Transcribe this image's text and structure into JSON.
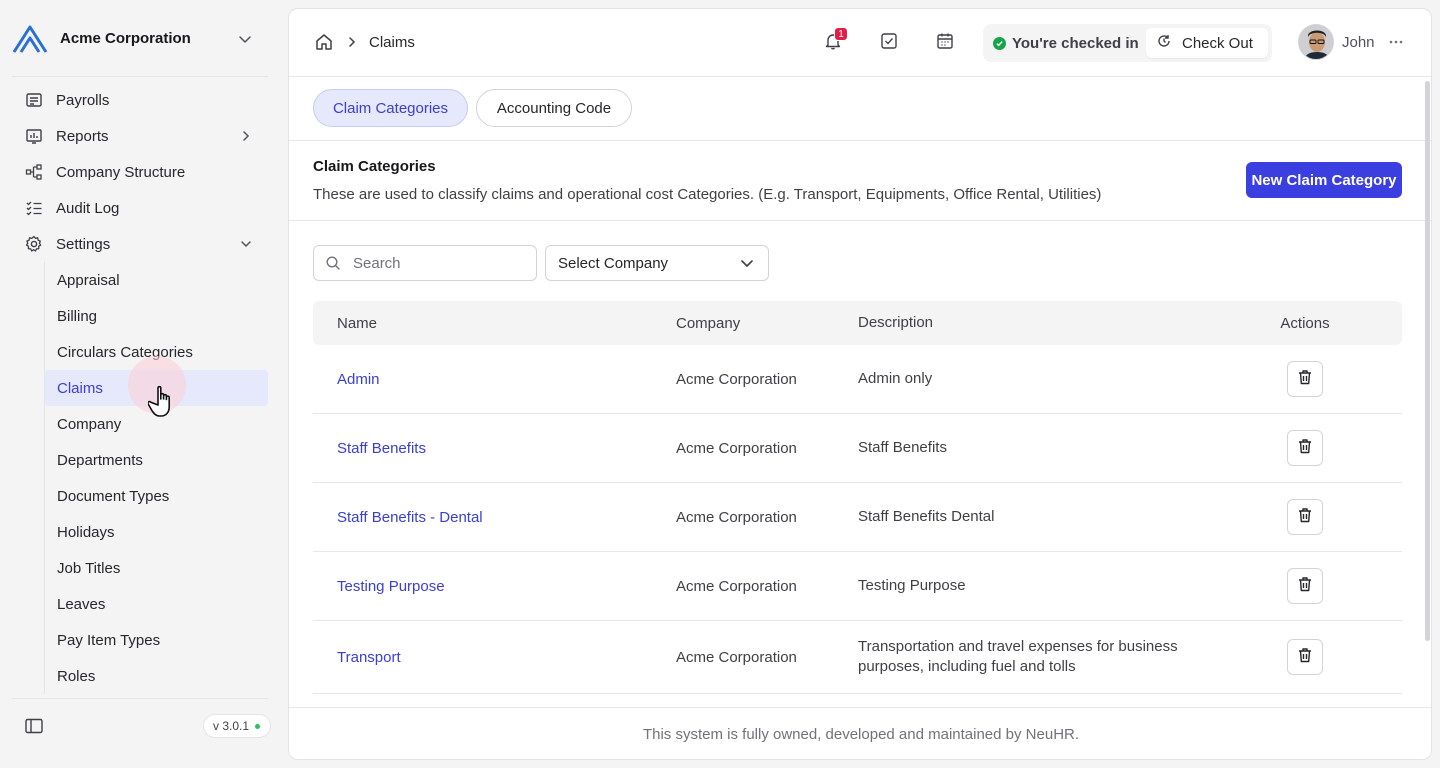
{
  "company": {
    "name": "Acme Corporation"
  },
  "sidebar": {
    "items": [
      {
        "label": "Payrolls",
        "icon": "payrolls-icon"
      },
      {
        "label": "Reports",
        "icon": "reports-icon"
      },
      {
        "label": "Company Structure",
        "icon": "company-structure-icon"
      },
      {
        "label": "Audit Log",
        "icon": "audit-log-icon"
      },
      {
        "label": "Settings",
        "icon": "settings-icon"
      }
    ],
    "settings_sub": [
      "Appraisal",
      "Billing",
      "Circulars Categories",
      "Claims",
      "Company",
      "Departments",
      "Document Types",
      "Holidays",
      "Job Titles",
      "Leaves",
      "Pay Item Types",
      "Roles"
    ],
    "active_sub": "Claims",
    "version": "v 3.0.1"
  },
  "header": {
    "breadcrumb_current": "Claims",
    "notification_count": "1",
    "checkin_status": "You're checked in",
    "checkout_label": "Check Out",
    "user_name": "John"
  },
  "tabs": [
    {
      "label": "Claim Categories",
      "active": true
    },
    {
      "label": "Accounting Code",
      "active": false
    }
  ],
  "section": {
    "title": "Claim Categories",
    "description": "These are used to classify claims and operational cost Categories. (E.g. Transport, Equipments, Office Rental, Utilities)",
    "new_button": "New Claim Category"
  },
  "filters": {
    "search_placeholder": "Search",
    "company_select": "Select Company"
  },
  "table": {
    "headers": {
      "name": "Name",
      "company": "Company",
      "description": "Description",
      "actions": "Actions"
    },
    "rows": [
      {
        "name": "Admin",
        "company": "Acme Corporation",
        "description": "Admin only"
      },
      {
        "name": "Staff Benefits",
        "company": "Acme Corporation",
        "description": "Staff Benefits"
      },
      {
        "name": "Staff Benefits - Dental",
        "company": "Acme Corporation",
        "description": "Staff Benefits Dental"
      },
      {
        "name": "Testing Purpose",
        "company": "Acme Corporation",
        "description": "Testing Purpose"
      },
      {
        "name": "Transport",
        "company": "Acme Corporation",
        "description": "Transportation and travel expenses for business purposes, including fuel and tolls"
      }
    ]
  },
  "footer": {
    "text": "This system is fully owned, developed and maintained by NeuHR."
  },
  "colors": {
    "accent": "#3b3fe0",
    "accent_text": "#3b3fcf",
    "active_bg": "#e6e8fb",
    "status_ok": "#16a34a",
    "badge": "#e11d48"
  }
}
